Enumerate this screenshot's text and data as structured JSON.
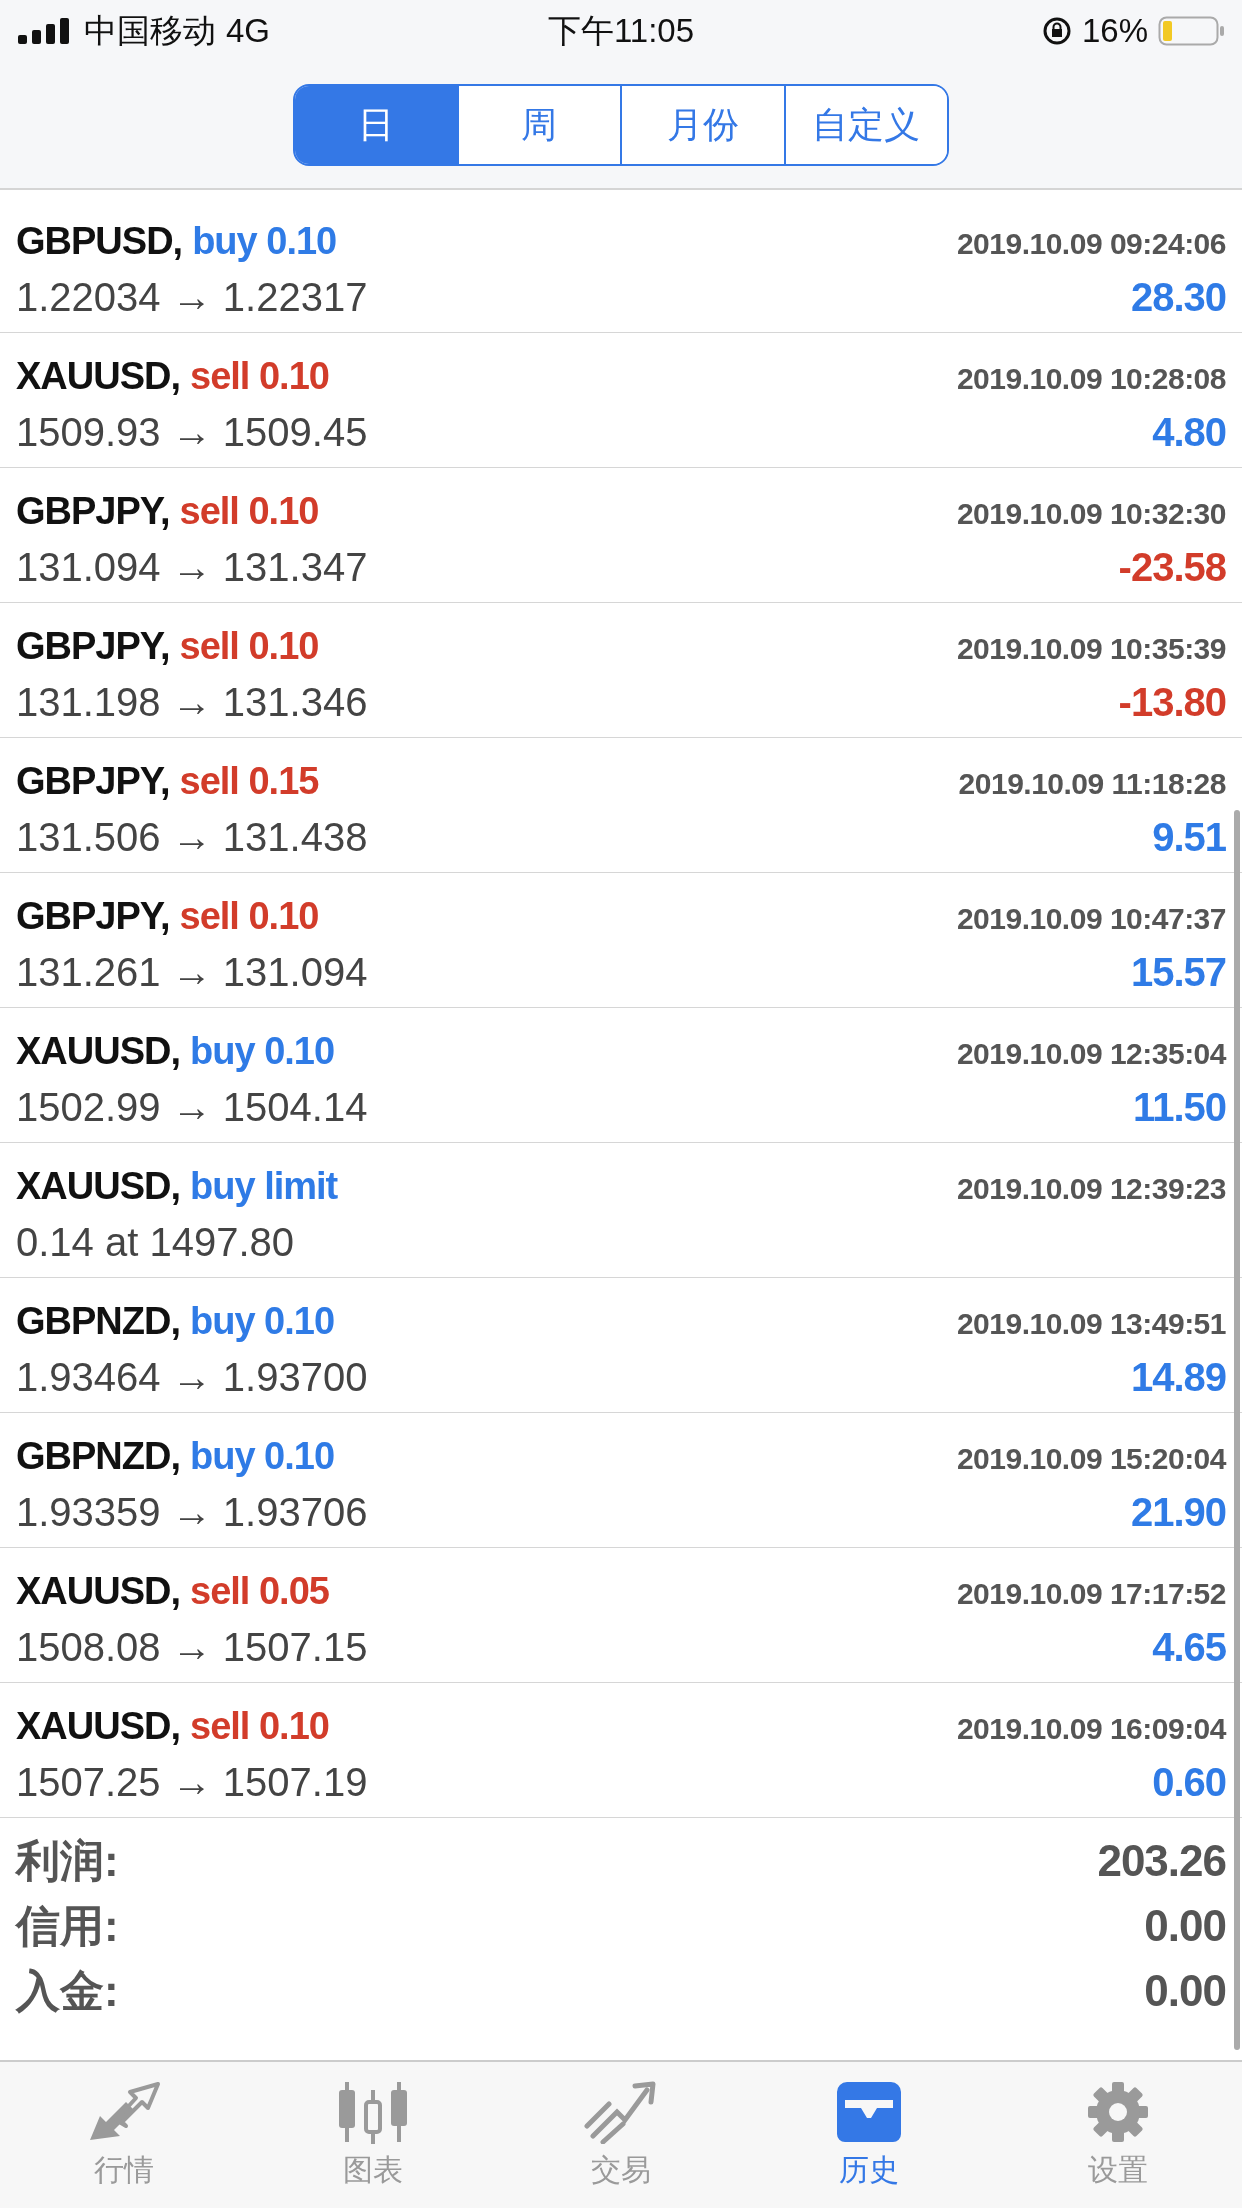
{
  "status_bar": {
    "carrier": "中国移动",
    "network": "4G",
    "time": "下午11:05",
    "battery": "16%"
  },
  "period_tabs": [
    {
      "label": "日",
      "selected": true
    },
    {
      "label": "周",
      "selected": false
    },
    {
      "label": "月份",
      "selected": false
    },
    {
      "label": "自定义",
      "selected": false
    }
  ],
  "orders": [
    {
      "symbol": "GBPUSD,",
      "kind": "buy",
      "order": "buy 0.10",
      "time": "2019.10.09 09:24:06",
      "prices": "1.22034 → 1.22317",
      "profit": "28.30",
      "loss": false
    },
    {
      "symbol": "XAUUSD,",
      "kind": "sell",
      "order": "sell 0.10",
      "time": "2019.10.09 10:28:08",
      "prices": "1509.93 → 1509.45",
      "profit": "4.80",
      "loss": false
    },
    {
      "symbol": "GBPJPY,",
      "kind": "sell",
      "order": "sell 0.10",
      "time": "2019.10.09 10:32:30",
      "prices": "131.094 → 131.347",
      "profit": "-23.58",
      "loss": true
    },
    {
      "symbol": "GBPJPY,",
      "kind": "sell",
      "order": "sell 0.10",
      "time": "2019.10.09 10:35:39",
      "prices": "131.198 → 131.346",
      "profit": "-13.80",
      "loss": true
    },
    {
      "symbol": "GBPJPY,",
      "kind": "sell",
      "order": "sell 0.15",
      "time": "2019.10.09 11:18:28",
      "prices": "131.506 → 131.438",
      "profit": "9.51",
      "loss": false
    },
    {
      "symbol": "GBPJPY,",
      "kind": "sell",
      "order": "sell 0.10",
      "time": "2019.10.09 10:47:37",
      "prices": "131.261 → 131.094",
      "profit": "15.57",
      "loss": false
    },
    {
      "symbol": "XAUUSD,",
      "kind": "buy",
      "order": "buy 0.10",
      "time": "2019.10.09 12:35:04",
      "prices": "1502.99 → 1504.14",
      "profit": "11.50",
      "loss": false
    },
    {
      "symbol": "XAUUSD,",
      "kind": "buy",
      "order": "buy limit",
      "time": "2019.10.09 12:39:23",
      "prices": "0.14 at 1497.80"
    },
    {
      "symbol": "GBPNZD,",
      "kind": "buy",
      "order": "buy 0.10",
      "time": "2019.10.09 13:49:51",
      "prices": "1.93464 → 1.93700",
      "profit": "14.89",
      "loss": false
    },
    {
      "symbol": "GBPNZD,",
      "kind": "buy",
      "order": "buy 0.10",
      "time": "2019.10.09 15:20:04",
      "prices": "1.93359 → 1.93706",
      "profit": "21.90",
      "loss": false
    },
    {
      "symbol": "XAUUSD,",
      "kind": "sell",
      "order": "sell 0.05",
      "time": "2019.10.09 17:17:52",
      "prices": "1508.08 → 1507.15",
      "profit": "4.65",
      "loss": false
    },
    {
      "symbol": "XAUUSD,",
      "kind": "sell",
      "order": "sell 0.10",
      "time": "2019.10.09 16:09:04",
      "prices": "1507.25 → 1507.19",
      "profit": "0.60",
      "loss": false
    }
  ],
  "summary": [
    {
      "label": "利润:",
      "value": "203.26"
    },
    {
      "label": "信用:",
      "value": "0.00"
    },
    {
      "label": "入金:",
      "value": "0.00"
    }
  ],
  "tab_bar": [
    {
      "kind": "quotes",
      "label": "行情",
      "selected": false
    },
    {
      "kind": "chart",
      "label": "图表",
      "selected": false
    },
    {
      "kind": "trade",
      "label": "交易",
      "selected": false
    },
    {
      "kind": "history",
      "label": "历史",
      "selected": true
    },
    {
      "kind": "settings",
      "label": "设置",
      "selected": false
    }
  ]
}
